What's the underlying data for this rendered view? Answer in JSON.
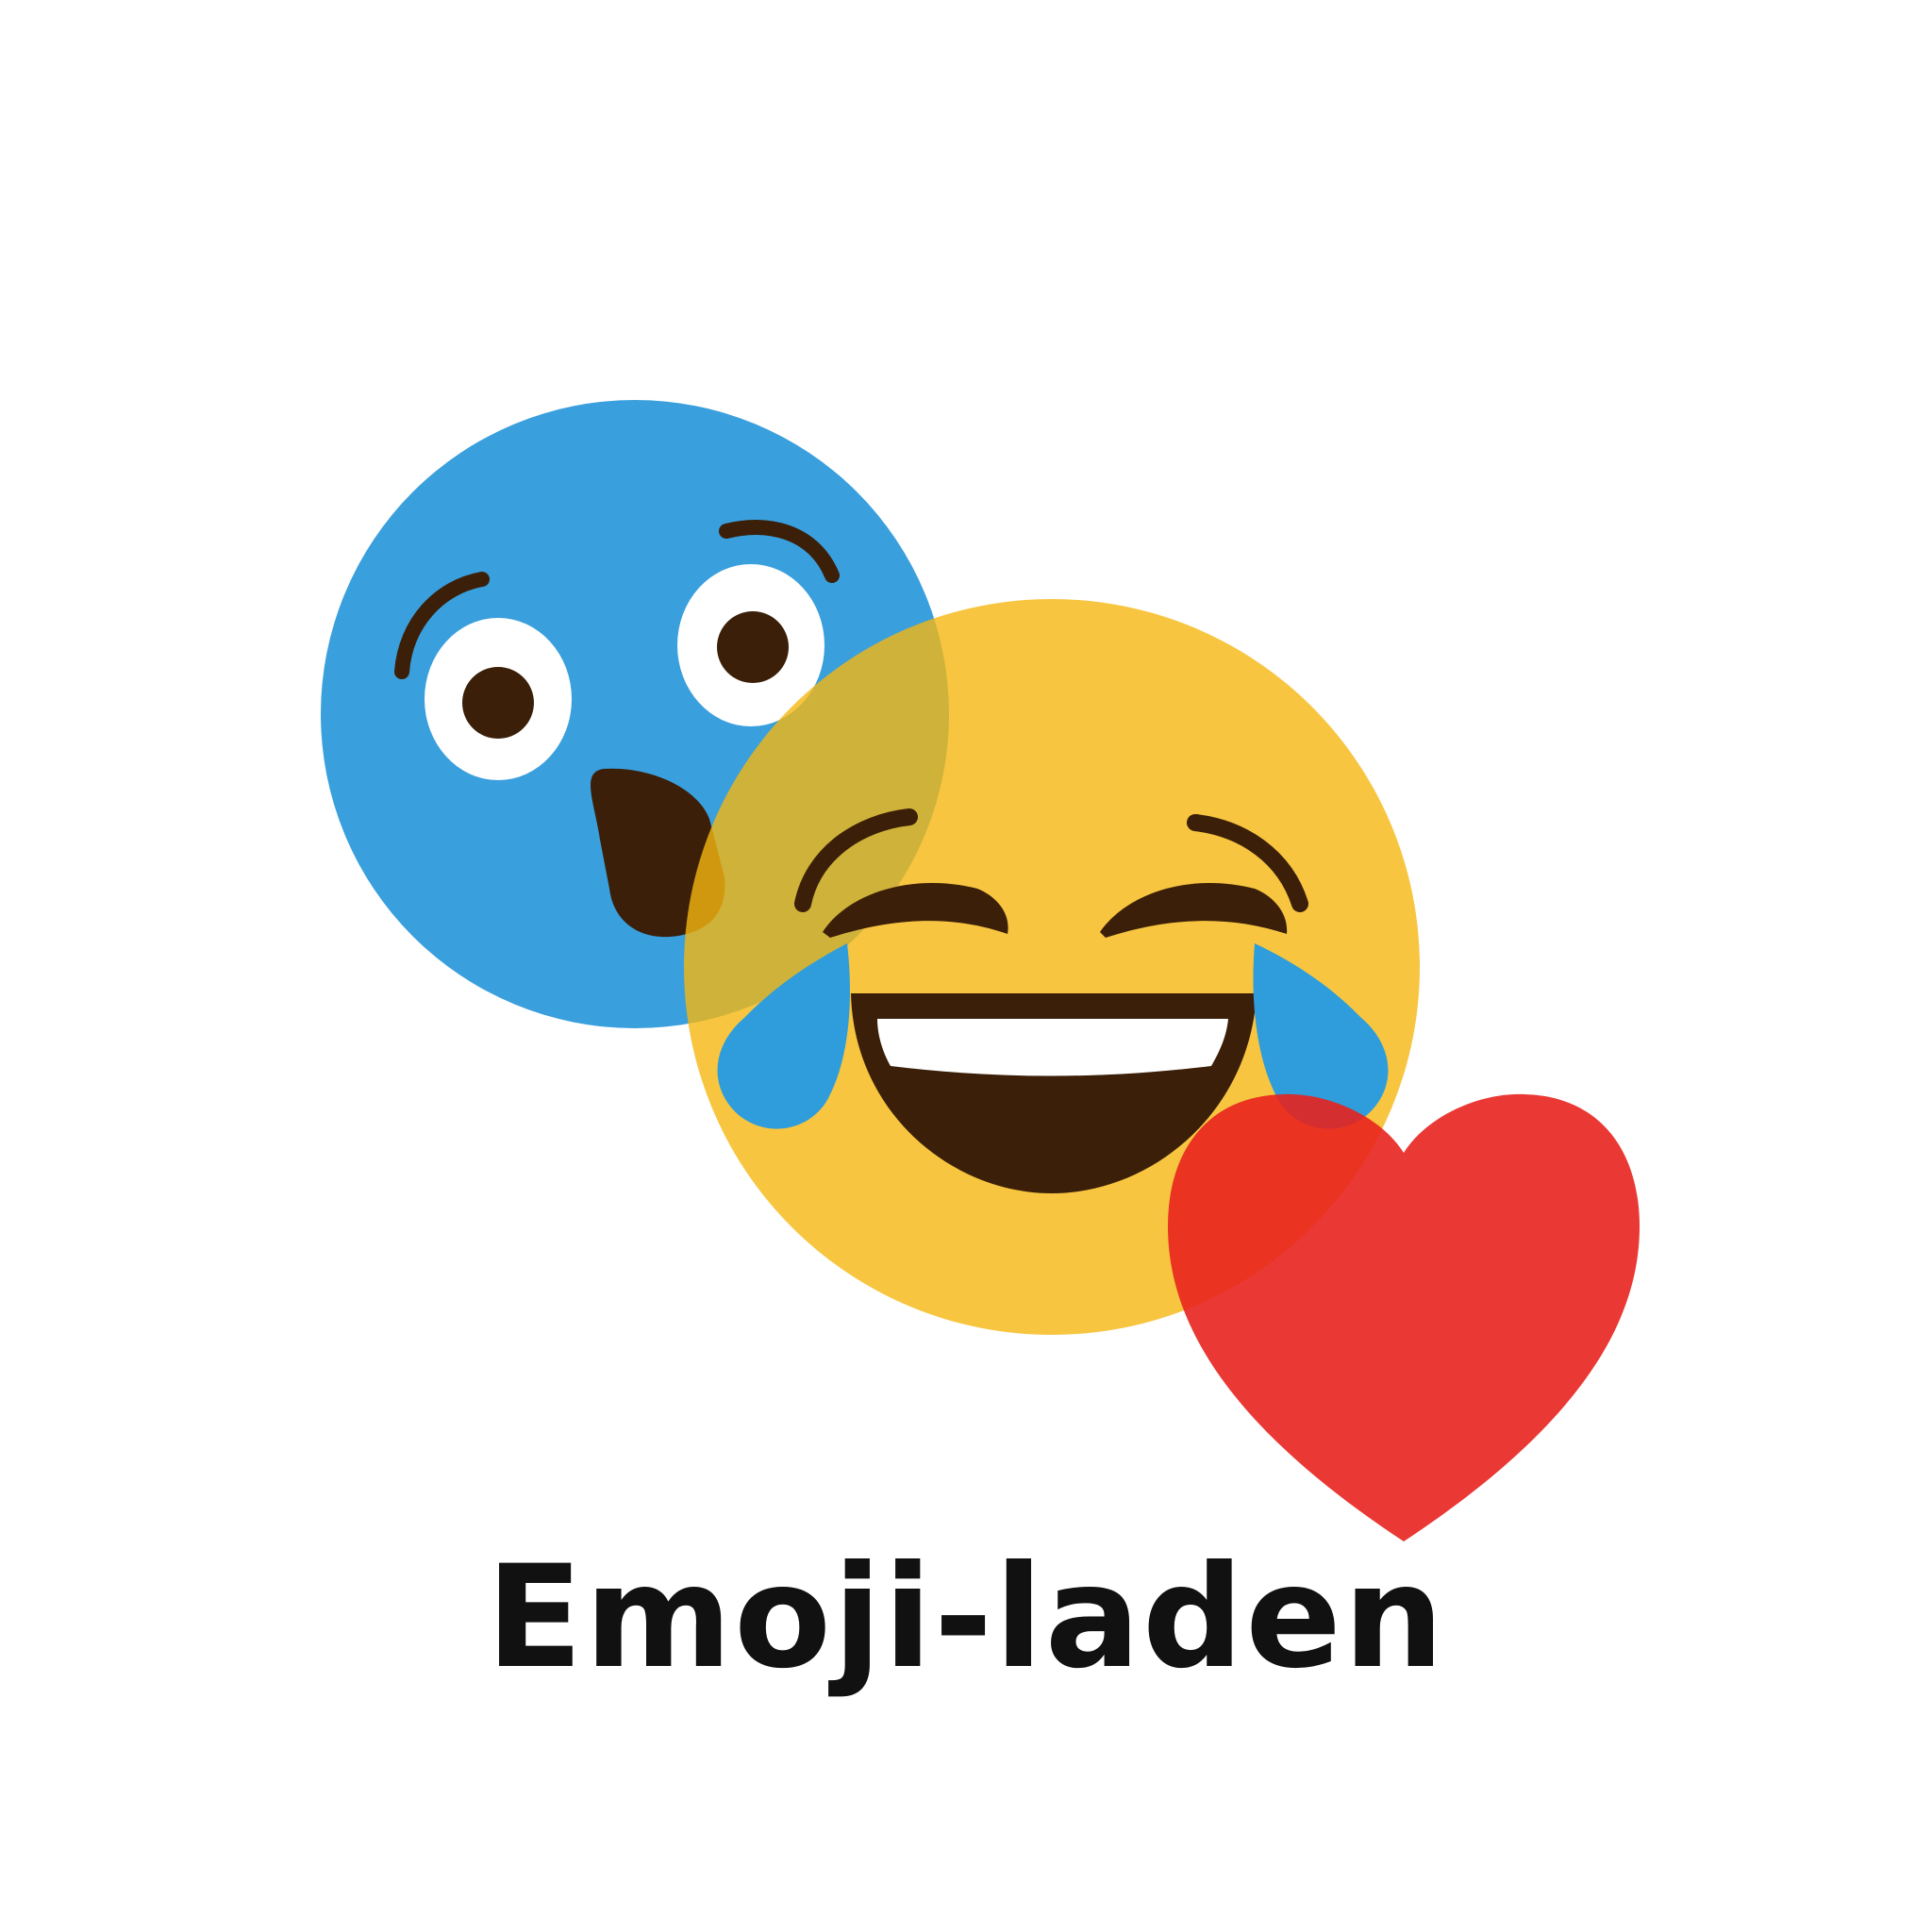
{
  "caption": "Emoji-laden",
  "emojis": [
    {
      "icon": "astonished-face-icon",
      "color": "#3a9fdd"
    },
    {
      "icon": "face-with-tears-of-joy-icon",
      "color": "#f8c33d"
    },
    {
      "icon": "red-heart-icon",
      "color": "#e8221e"
    }
  ],
  "colors": {
    "background": "#ffffff",
    "features": "#3b1f08",
    "tears": "#2f9ddb",
    "caption": "#111111"
  }
}
